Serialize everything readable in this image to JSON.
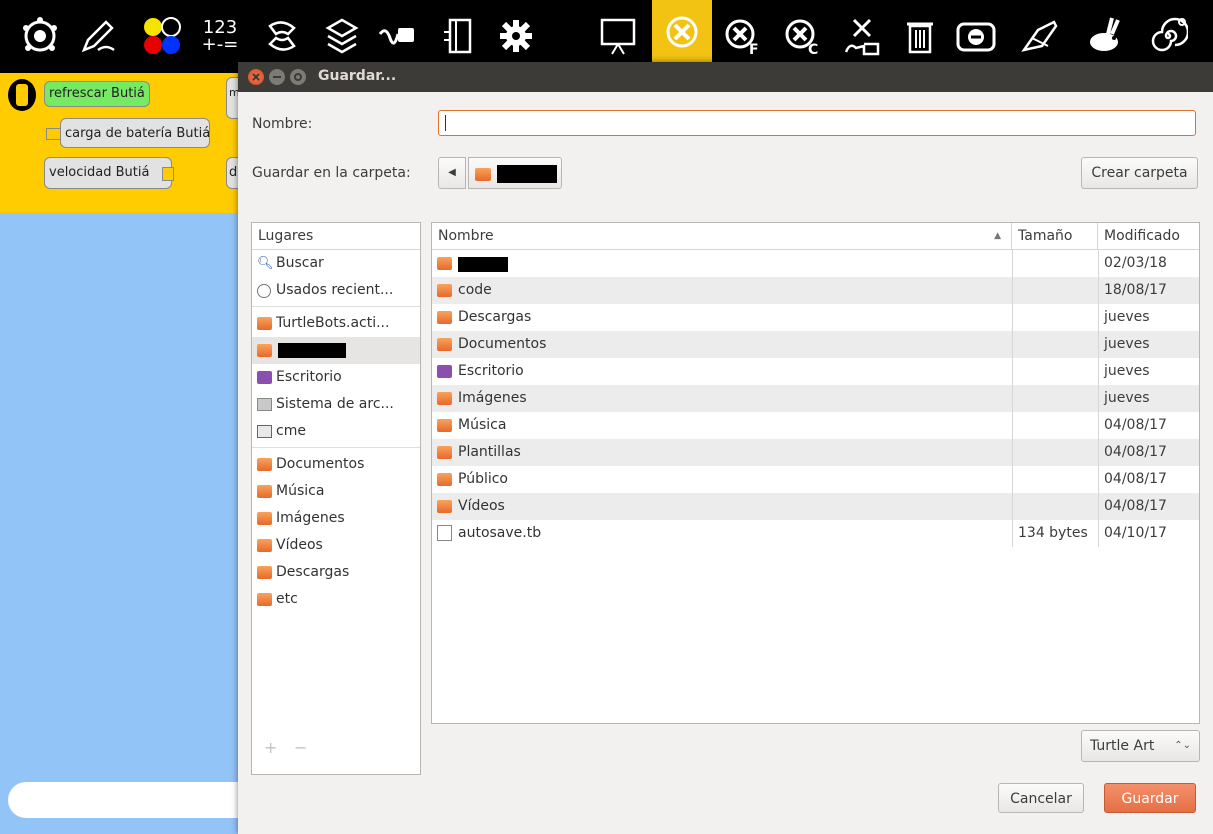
{
  "toolbar": {
    "number_top": "123",
    "number_bottom": "+-=",
    "icons": [
      "turtle-icon",
      "pen-icon",
      "colors-icon",
      "numbers-icon",
      "flow-icon",
      "blocks-icon",
      "sensors-icon",
      "media-icon",
      "extras-icon",
      "presentation-icon",
      "stop-icon",
      "clean-icon",
      "clear-icon",
      "run-icon",
      "trash-icon",
      "collapse-icon",
      "eraser-icon",
      "fast-icon",
      "slow-icon"
    ]
  },
  "palette": {
    "blocks": [
      "refrescar Butiá",
      "carga de batería Butiá",
      "velocidad Butiá"
    ],
    "partial_a": "m",
    "partial_b": "d"
  },
  "dialog": {
    "title": "Guardar...",
    "name_label": "Nombre:",
    "name_value": "",
    "folder_label": "Guardar en la carpeta:",
    "create_folder": "Crear carpeta",
    "places_header": "Lugares",
    "places": [
      {
        "label": "Buscar",
        "icon": "search-icon"
      },
      {
        "label": "Usados recient...",
        "icon": "recent-icon"
      },
      {
        "label": "TurtleBots.acti...",
        "icon": "folder-icon"
      },
      {
        "label": "",
        "icon": "home-folder-icon",
        "redacted": true
      },
      {
        "label": "Escritorio",
        "icon": "desktop-icon"
      },
      {
        "label": "Sistema de arc...",
        "icon": "drive-icon"
      },
      {
        "label": "cme",
        "icon": "drive-icon"
      },
      {
        "label": "Documentos",
        "icon": "documents-icon"
      },
      {
        "label": "Música",
        "icon": "music-icon"
      },
      {
        "label": "Imágenes",
        "icon": "pictures-icon"
      },
      {
        "label": "Vídeos",
        "icon": "videos-icon"
      },
      {
        "label": "Descargas",
        "icon": "downloads-icon"
      },
      {
        "label": "etc",
        "icon": "folder-icon"
      }
    ],
    "columns": {
      "name": "Nombre",
      "size": "Tamaño",
      "modified": "Modificado"
    },
    "files": [
      {
        "name": "",
        "size": "",
        "modified": "02/03/18",
        "redacted": true
      },
      {
        "name": "code",
        "size": "",
        "modified": "18/08/17"
      },
      {
        "name": "Descargas",
        "size": "",
        "modified": "jueves"
      },
      {
        "name": "Documentos",
        "size": "",
        "modified": "jueves"
      },
      {
        "name": "Escritorio",
        "size": "",
        "modified": "jueves"
      },
      {
        "name": "Imágenes",
        "size": "",
        "modified": "jueves"
      },
      {
        "name": "Música",
        "size": "",
        "modified": "04/08/17"
      },
      {
        "name": "Plantillas",
        "size": "",
        "modified": "04/08/17"
      },
      {
        "name": "Público",
        "size": "",
        "modified": "04/08/17"
      },
      {
        "name": "Vídeos",
        "size": "",
        "modified": "04/08/17"
      },
      {
        "name": "autosave.tb",
        "size": "134 bytes",
        "modified": "04/10/17"
      }
    ],
    "add_symbol": "+",
    "remove_symbol": "−",
    "filter": "Turtle Art",
    "filter_arrows": "⌃⌄",
    "cancel": "Cancelar",
    "save": "Guardar"
  },
  "colors": {
    "accent": "#e56f45",
    "palette_bg": "#fecc00",
    "canvas_bg": "#93c4f7",
    "titlebar": "#3c3b37"
  }
}
